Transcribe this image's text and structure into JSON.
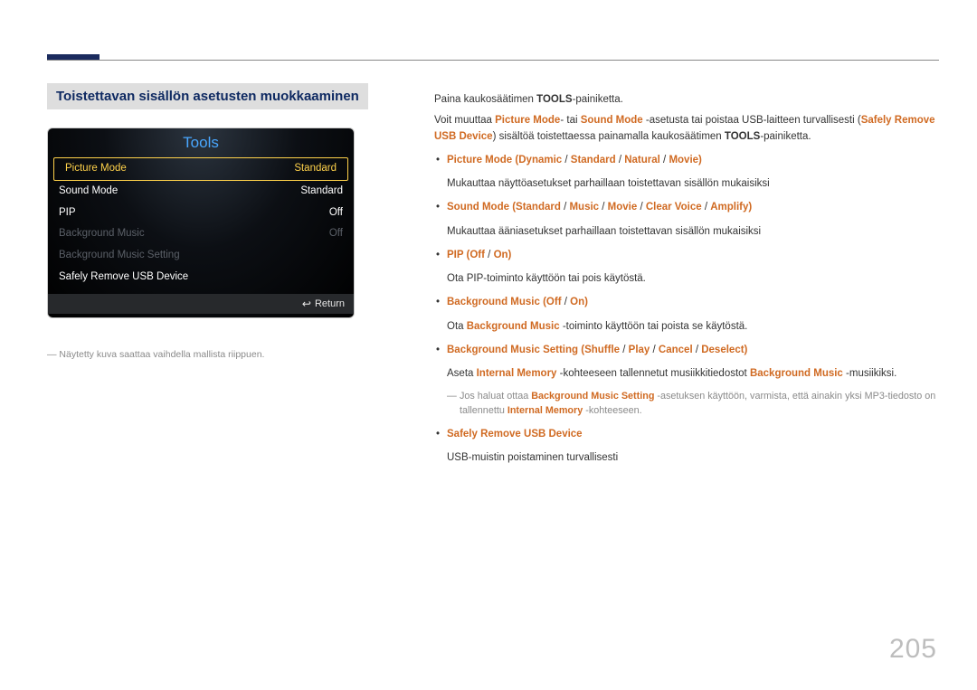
{
  "page_number": "205",
  "section_heading": "Toistettavan sisällön asetusten muokkaaminen",
  "footnote_left": "― Näytetty kuva saattaa vaihdella mallista riippuen.",
  "tools_panel": {
    "title": "Tools",
    "rows": [
      {
        "label": "Picture Mode",
        "value": "Standard",
        "state": "selected"
      },
      {
        "label": "Sound Mode",
        "value": "Standard",
        "state": "normal"
      },
      {
        "label": "PIP",
        "value": "Off",
        "state": "normal"
      },
      {
        "label": "Background Music",
        "value": "Off",
        "state": "dim"
      },
      {
        "label": "Background Music Setting",
        "value": "",
        "state": "dim"
      },
      {
        "label": "Safely Remove USB Device",
        "value": "",
        "state": "normal"
      }
    ],
    "footer": {
      "glyph": "↩",
      "label": "Return"
    }
  },
  "right": {
    "p1_a": "Paina kaukosäätimen ",
    "p1_b": "TOOLS",
    "p1_c": "-painiketta.",
    "p2_a": "Voit muuttaa ",
    "p2_pm": "Picture Mode",
    "p2_b": "- tai ",
    "p2_sm": "Sound Mode",
    "p2_c": " -asetusta tai poistaa USB-laitteen turvallisesti (",
    "p2_sr": "Safely Remove USB Device",
    "p2_d": ") sisältöä toistettaessa painamalla kaukosäätimen ",
    "p2_tools": "TOOLS",
    "p2_e": "-painiketta.",
    "b1": {
      "name": "Picture Mode",
      "opts": [
        "Dynamic",
        "Standard",
        "Natural",
        "Movie"
      ],
      "desc": "Mukauttaa näyttöasetukset parhaillaan toistettavan sisällön mukaisiksi"
    },
    "b2": {
      "name": "Sound Mode",
      "opts": [
        "Standard",
        "Music",
        "Movie",
        "Clear Voice",
        "Amplify"
      ],
      "desc": "Mukauttaa ääniasetukset parhaillaan toistettavan sisällön mukaisiksi"
    },
    "b3": {
      "name": "PIP",
      "opts": [
        "Off",
        "On"
      ],
      "desc": "Ota PIP-toiminto käyttöön tai pois käytöstä."
    },
    "b4": {
      "name": "Background Music",
      "opts": [
        "Off",
        "On"
      ],
      "desc_a": "Ota ",
      "desc_h": "Background Music",
      "desc_b": " -toiminto käyttöön tai poista se käytöstä."
    },
    "b5": {
      "name": "Background Music Setting",
      "opts": [
        "Shuffle",
        "Play",
        "Cancel",
        "Deselect"
      ],
      "d2_a": "Aseta ",
      "d2_h1": "Internal Memory",
      "d2_b": " -kohteeseen tallennetut musiikkitiedostot ",
      "d2_h2": "Background Music",
      "d2_c": " -musiikiksi."
    },
    "note": {
      "a": "Jos haluat ottaa ",
      "h1": "Background Music Setting",
      "b": " -asetuksen käyttöön, varmista, että ainakin yksi MP3-tiedosto on tallennettu ",
      "h2": "Internal Memory",
      "c": " -kohteeseen."
    },
    "b6": {
      "name": "Safely Remove USB Device",
      "desc": "USB-muistin poistaminen turvallisesti"
    }
  }
}
